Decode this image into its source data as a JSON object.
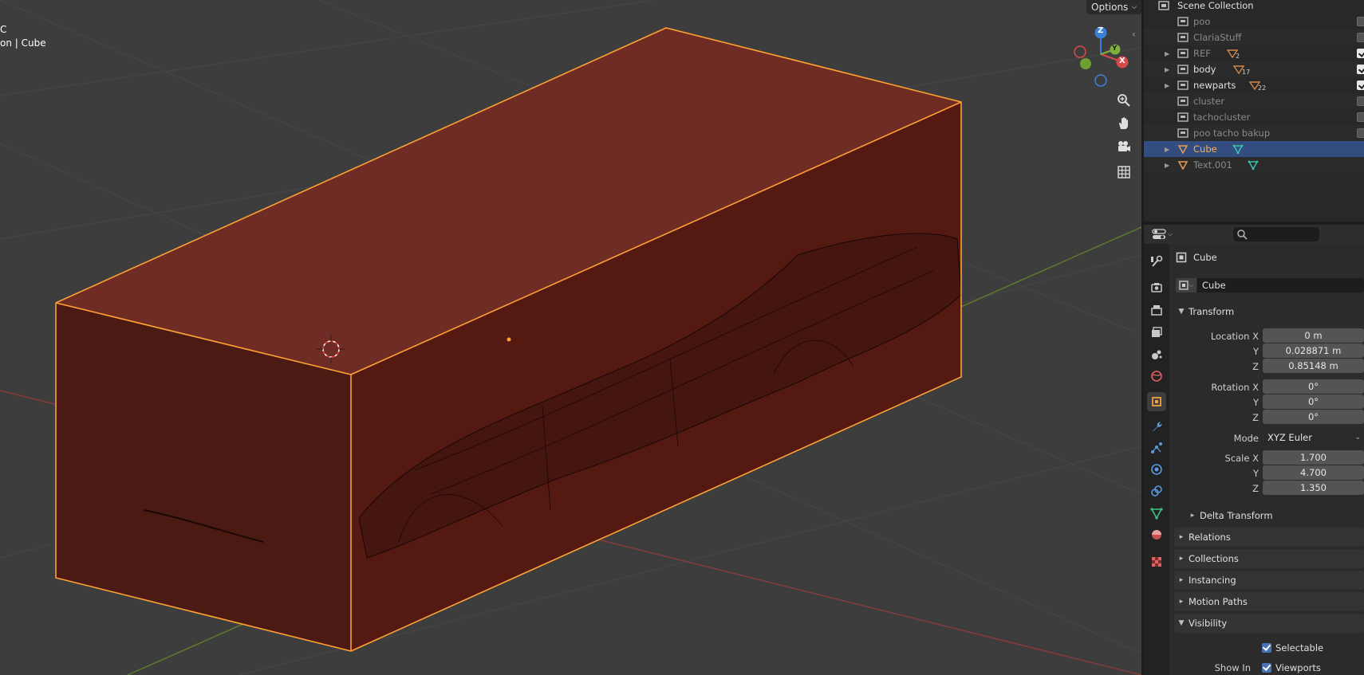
{
  "viewport": {
    "header_partial": "C",
    "object_info": "on | Cube",
    "options_label": "Options",
    "gizmo": {
      "x": "X",
      "y": "Y",
      "z": "Z"
    }
  },
  "outliner": {
    "title": "Scene Collection",
    "items": [
      {
        "label": "poo",
        "type": "collection",
        "expandable": false,
        "checked": false,
        "dim": true
      },
      {
        "label": "ClariaStuff",
        "type": "collection",
        "expandable": false,
        "checked": false,
        "dim": true
      },
      {
        "label": "REF",
        "type": "collection",
        "expandable": true,
        "checked": true,
        "dim": true,
        "badge": "2"
      },
      {
        "label": "body",
        "type": "collection",
        "expandable": true,
        "checked": true,
        "dim": false,
        "badge": "17"
      },
      {
        "label": "newparts",
        "type": "collection",
        "expandable": true,
        "checked": true,
        "dim": false,
        "badge": "22"
      },
      {
        "label": "cluster",
        "type": "collection",
        "expandable": false,
        "checked": false,
        "dim": true
      },
      {
        "label": "tachocluster",
        "type": "collection",
        "expandable": false,
        "checked": false,
        "dim": true
      },
      {
        "label": "poo tacho bakup",
        "type": "collection",
        "expandable": false,
        "checked": false,
        "dim": true
      },
      {
        "label": "Cube",
        "type": "mesh",
        "expandable": true,
        "selected": true
      },
      {
        "label": "Text.001",
        "type": "mesh",
        "expandable": true,
        "dim": true
      }
    ]
  },
  "properties": {
    "object_name": "Cube",
    "datablock_name": "Cube",
    "transform": {
      "title": "Transform",
      "location_label": "Location X",
      "location": [
        "0 m",
        "0.028871 m",
        "0.85148 m"
      ],
      "rotation_label": "Rotation X",
      "rotation": [
        "0°",
        "0°",
        "0°"
      ],
      "mode_label": "Mode",
      "mode_value": "XYZ Euler",
      "scale_label": "Scale X",
      "scale": [
        "1.700",
        "4.700",
        "1.350"
      ],
      "axis_y": "Y",
      "axis_z": "Z",
      "delta": "Delta Transform"
    },
    "panels": [
      "Relations",
      "Collections",
      "Instancing",
      "Motion Paths"
    ],
    "visibility": {
      "title": "Visibility",
      "selectable": "Selectable",
      "show_in": "Show In",
      "viewports": "Viewports"
    }
  },
  "colors": {
    "selection_orange": "#ffa033",
    "cube_face": "#5a2018",
    "outliner_selected": "#334d80",
    "accent_blue": "#4772b3"
  }
}
